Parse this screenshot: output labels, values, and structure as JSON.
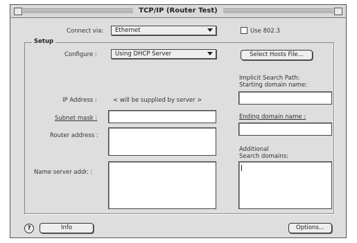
{
  "window": {
    "title": "TCP/IP (Router Test)"
  },
  "connect": {
    "label": "Connect via:",
    "value": "Ethernet"
  },
  "use8023": {
    "label": "Use 802.3",
    "checked": false
  },
  "setup": {
    "title": "Setup",
    "configure": {
      "label": "Configure :",
      "value": "Using DHCP Server"
    },
    "select_hosts_button": "Select Hosts File...",
    "ip_address": {
      "label": "IP Address :",
      "value": "< will be supplied by server >"
    },
    "subnet_mask": {
      "label": "Subnet mask :",
      "value": ""
    },
    "router_address": {
      "label": "Router address :",
      "value": ""
    },
    "name_server": {
      "label": "Name server addr. :",
      "value": ""
    },
    "implicit_search": {
      "label_line1": "Implicit Search Path:",
      "label_line2": "Starting domain name:",
      "value": ""
    },
    "ending_domain": {
      "label": "Ending domain name :",
      "value": ""
    },
    "additional_search": {
      "label_line1": "Additional",
      "label_line2": "Search domains:",
      "value": ""
    }
  },
  "footer": {
    "help_icon": "?",
    "info_button": "Info",
    "options_button": "Options..."
  },
  "icons": {
    "close": "close-box-icon",
    "zoom": "zoom-box-icon",
    "help": "help-icon",
    "popup_arrow": "triangle-down-icon"
  }
}
